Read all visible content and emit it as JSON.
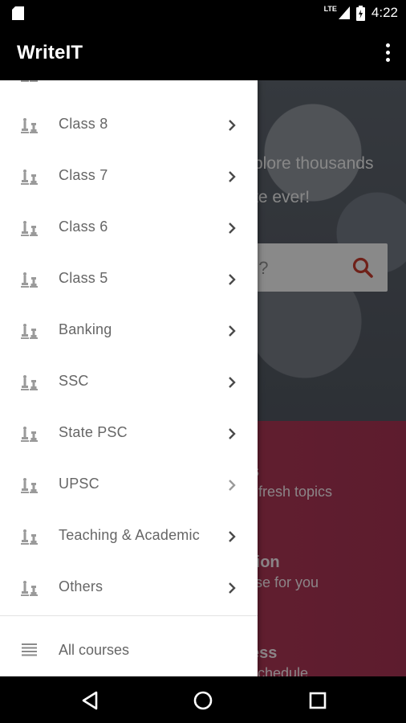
{
  "status_bar": {
    "network": "LTE",
    "time": "4:22"
  },
  "app_bar": {
    "title": "WriteIT"
  },
  "background": {
    "hero_line_1": "plore thousands",
    "hero_line_2": "te ever!",
    "search_placeholder": "n?",
    "panel_heading_1": "s",
    "panel_sub_1": "f fresh topics",
    "panel_heading_2": "tion",
    "panel_sub_2": "rse for you",
    "panel_heading_3": "ess",
    "panel_sub_3": "schedule"
  },
  "drawer": {
    "items": [
      {
        "label": "Class 8"
      },
      {
        "label": "Class 7"
      },
      {
        "label": "Class 6"
      },
      {
        "label": "Class 5"
      },
      {
        "label": "Banking"
      },
      {
        "label": "SSC"
      },
      {
        "label": "State PSC"
      },
      {
        "label": "UPSC"
      },
      {
        "label": "Teaching & Academic"
      },
      {
        "label": "Others"
      }
    ],
    "all_courses": "All courses"
  },
  "colors": {
    "accent": "#b03a55",
    "search_icon": "#c0392b"
  },
  "icons": {
    "drawer_item": "chess-pieces-icon",
    "chevron": "chevron-right-icon",
    "all_courses": "list-icon"
  }
}
